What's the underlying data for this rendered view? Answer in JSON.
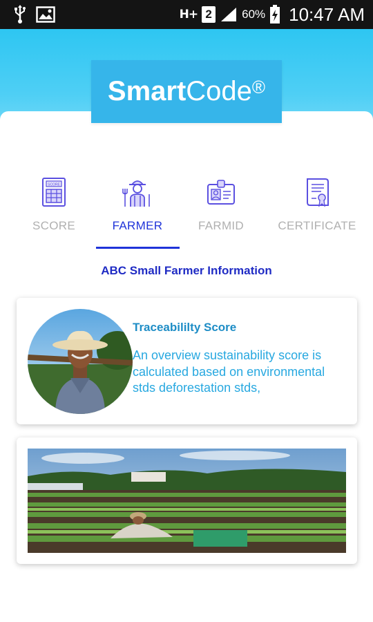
{
  "status_bar": {
    "network": "H+",
    "sim": "2",
    "battery": "60%",
    "time": "10:47 AM",
    "icons": [
      "usb-icon",
      "image-icon",
      "signal-icon",
      "battery-icon"
    ]
  },
  "logo": {
    "bold": "Smart",
    "normal": "Code",
    "mark": "®"
  },
  "tabs": [
    {
      "label": "SCORE",
      "icon": "scorecard-icon",
      "active": false
    },
    {
      "label": "FARMER",
      "icon": "farmer-icon",
      "active": true
    },
    {
      "label": "FARMID",
      "icon": "id-card-icon",
      "active": false
    },
    {
      "label": "CERTIFICATE",
      "icon": "certificate-icon",
      "active": false
    }
  ],
  "section_title": "ABC Small Farmer Information",
  "info_card": {
    "title": "Traceabililty Score",
    "description": "An overview sustainability score is calculated based on environmental stds deforestation stds,"
  },
  "colors": {
    "accent": "#1f33d9",
    "header": "#2ec6f2",
    "logo_bg": "#36b5ea",
    "card_title": "#1e8dc6",
    "card_text": "#27a8e0",
    "inactive_tab": "#b0b0b0"
  }
}
